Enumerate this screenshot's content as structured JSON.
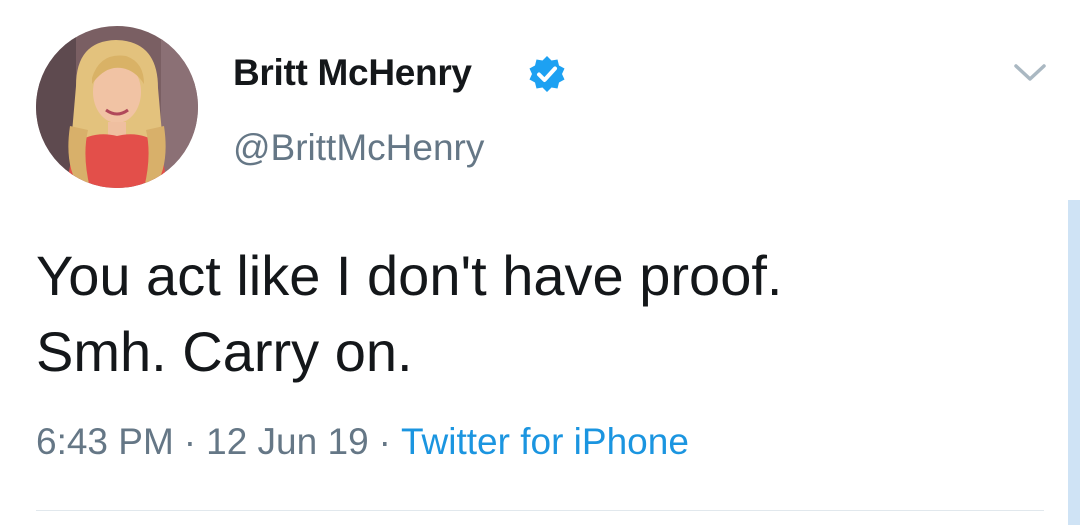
{
  "user": {
    "display_name": "Britt McHenry",
    "handle": "@BrittMcHenry",
    "verified": true,
    "avatar_icon": "profile-photo"
  },
  "tweet": {
    "text_lines": [
      "You act like I don't have proof.",
      "Smh. Carry on."
    ],
    "time": "6:43 PM",
    "date": "12 Jun 19",
    "source": "Twitter for iPhone",
    "separator": "·"
  },
  "menu": {
    "icon": "chevron-down-icon"
  },
  "colors": {
    "text_primary": "#14171a",
    "text_secondary": "#657786",
    "link": "#1b95e0",
    "verified": "#1da1f2",
    "divider": "#e1e8ed"
  }
}
